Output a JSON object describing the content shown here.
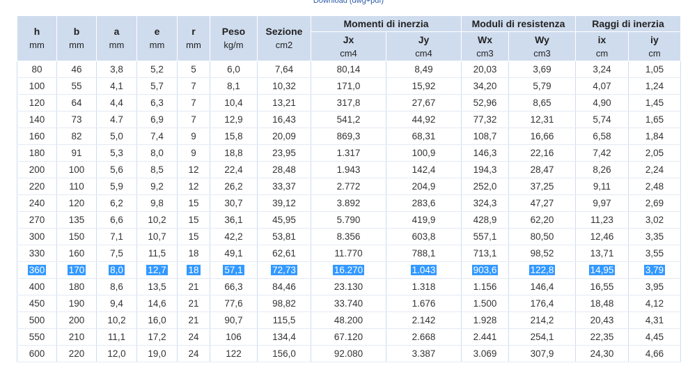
{
  "download_link": "Download (dwg+pdf)",
  "groups": [
    {
      "label": "Momenti di inerzia",
      "span": 2
    },
    {
      "label": "Moduli di resistenza",
      "span": 2
    },
    {
      "label": "Raggi di inerzia",
      "span": 2
    }
  ],
  "columns": [
    {
      "name": "h",
      "unit": "mm"
    },
    {
      "name": "b",
      "unit": "mm"
    },
    {
      "name": "a",
      "unit": "mm"
    },
    {
      "name": "e",
      "unit": "mm"
    },
    {
      "name": "r",
      "unit": "mm"
    },
    {
      "name": "Peso",
      "unit": "kg/m"
    },
    {
      "name": "Sezione",
      "unit": "cm2"
    },
    {
      "name": "Jx",
      "unit": "cm4"
    },
    {
      "name": "Jy",
      "unit": "cm4"
    },
    {
      "name": "Wx",
      "unit": "cm3"
    },
    {
      "name": "Wy",
      "unit": "cm3"
    },
    {
      "name": "ix",
      "unit": "cm"
    },
    {
      "name": "iy",
      "unit": "cm"
    }
  ],
  "highlighted_row": 12,
  "rows": [
    [
      "80",
      "46",
      "3,8",
      "5,2",
      "5",
      "6,0",
      "7,64",
      "80,14",
      "8,49",
      "20,03",
      "3,69",
      "3,24",
      "1,05"
    ],
    [
      "100",
      "55",
      "4,1",
      "5,7",
      "7",
      "8,1",
      "10,32",
      "171,0",
      "15,92",
      "34,20",
      "5,79",
      "4,07",
      "1,24"
    ],
    [
      "120",
      "64",
      "4,4",
      "6,3",
      "7",
      "10,4",
      "13,21",
      "317,8",
      "27,67",
      "52,96",
      "8,65",
      "4,90",
      "1,45"
    ],
    [
      "140",
      "73",
      "4.7",
      "6,9",
      "7",
      "12,9",
      "16,43",
      "541,2",
      "44,92",
      "77,32",
      "12,31",
      "5,74",
      "1,65"
    ],
    [
      "160",
      "82",
      "5,0",
      "7,4",
      "9",
      "15,8",
      "20,09",
      "869,3",
      "68,31",
      "108,7",
      "16,66",
      "6,58",
      "1,84"
    ],
    [
      "180",
      "91",
      "5,3",
      "8,0",
      "9",
      "18,8",
      "23,95",
      "1.317",
      "100,9",
      "146,3",
      "22,16",
      "7,42",
      "2,05"
    ],
    [
      "200",
      "100",
      "5,6",
      "8,5",
      "12",
      "22,4",
      "28,48",
      "1.943",
      "142,4",
      "194,3",
      "28,47",
      "8,26",
      "2,24"
    ],
    [
      "220",
      "110",
      "5,9",
      "9,2",
      "12",
      "26,2",
      "33,37",
      "2.772",
      "204,9",
      "252,0",
      "37,25",
      "9,11",
      "2,48"
    ],
    [
      "240",
      "120",
      "6,2",
      "9,8",
      "15",
      "30,7",
      "39,12",
      "3.892",
      "283,6",
      "324,3",
      "47,27",
      "9,97",
      "2,69"
    ],
    [
      "270",
      "135",
      "6,6",
      "10,2",
      "15",
      "36,1",
      "45,95",
      "5.790",
      "419,9",
      "428,9",
      "62,20",
      "11,23",
      "3,02"
    ],
    [
      "300",
      "150",
      "7,1",
      "10,7",
      "15",
      "42,2",
      "53,81",
      "8.356",
      "603,8",
      "557,1",
      "80,50",
      "12,46",
      "3,35"
    ],
    [
      "330",
      "160",
      "7,5",
      "11,5",
      "18",
      "49,1",
      "62,61",
      "11.770",
      "788,1",
      "713,1",
      "98,52",
      "13,71",
      "3,55"
    ],
    [
      "360",
      "170",
      "8,0",
      "12,7",
      "18",
      "57,1",
      "72,73",
      "16.270",
      "1.043",
      "903,6",
      "122,8",
      "14,95",
      "3,79"
    ],
    [
      "400",
      "180",
      "8,6",
      "13,5",
      "21",
      "66,3",
      "84,46",
      "23.130",
      "1.318",
      "1.156",
      "146,4",
      "16,55",
      "3,95"
    ],
    [
      "450",
      "190",
      "9,4",
      "14,6",
      "21",
      "77,6",
      "98,82",
      "33.740",
      "1.676",
      "1.500",
      "176,4",
      "18,48",
      "4,12"
    ],
    [
      "500",
      "200",
      "10,2",
      "16,0",
      "21",
      "90,7",
      "115,5",
      "48.200",
      "2.142",
      "1.928",
      "214,2",
      "20,43",
      "4,31"
    ],
    [
      "550",
      "210",
      "11,1",
      "17,2",
      "24",
      "106",
      "134,4",
      "67.120",
      "2.668",
      "2.441",
      "254,1",
      "22,35",
      "4,45"
    ],
    [
      "600",
      "220",
      "12,0",
      "19,0",
      "24",
      "122",
      "156,0",
      "92.080",
      "3.387",
      "3.069",
      "307,9",
      "24,30",
      "4,66"
    ]
  ],
  "accent_color": "#3399ff",
  "header_bg": "#cfdcee"
}
